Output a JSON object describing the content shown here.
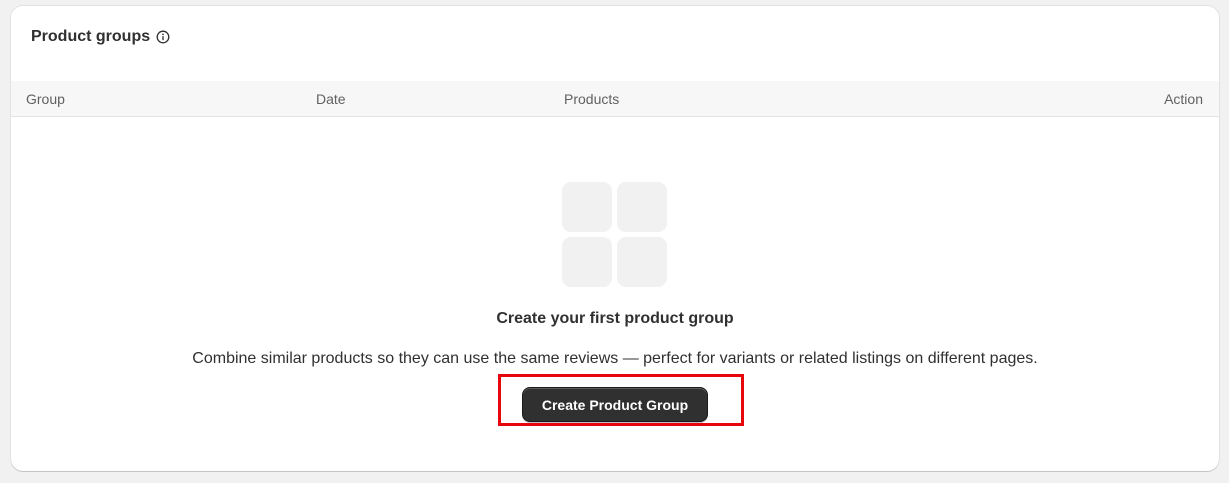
{
  "card": {
    "title": "Product groups",
    "info_icon": "info-circle-icon"
  },
  "table": {
    "columns": [
      "Group",
      "Date",
      "Products",
      "Action"
    ]
  },
  "empty_state": {
    "illustration_icon": "grid-four-tiles-icon",
    "title": "Create your first product group",
    "description": "Combine similar products so they can use the same reviews — perfect for variants or related listings on different pages.",
    "button_label": "Create Product Group"
  },
  "colors": {
    "background": "#f1f1f1",
    "card": "#ffffff",
    "button": "#303030",
    "highlight": "#e8050b"
  }
}
